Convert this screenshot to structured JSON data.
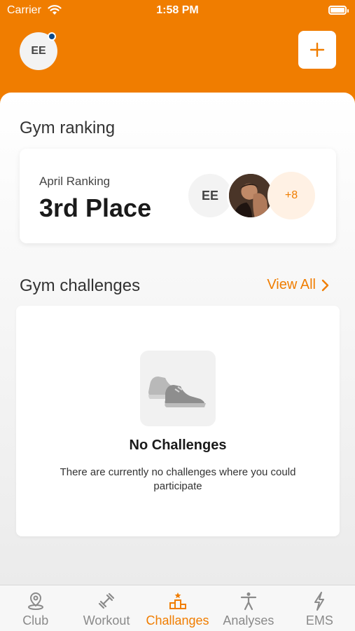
{
  "status": {
    "carrier": "Carrier",
    "time": "1:58 PM"
  },
  "header": {
    "avatar_initials": "EE",
    "add_label": "+"
  },
  "ranking": {
    "section_title": "Gym ranking",
    "month_label": "April Ranking",
    "place": "3rd Place",
    "avatar_initials": "EE",
    "more_count": "+8"
  },
  "challenges": {
    "section_title": "Gym challenges",
    "view_all": "View All",
    "empty_title": "No Challenges",
    "empty_desc": "There are currently no challenges where you could participate"
  },
  "tabs": [
    {
      "label": "Club",
      "icon": "location-pin-icon",
      "active": false
    },
    {
      "label": "Workout",
      "icon": "dumbbell-icon",
      "active": false
    },
    {
      "label": "Challanges",
      "icon": "podium-icon",
      "active": true
    },
    {
      "label": "Analyses",
      "icon": "person-icon",
      "active": false
    },
    {
      "label": "EMS",
      "icon": "lightning-icon",
      "active": false
    }
  ],
  "colors": {
    "accent": "#F07D00",
    "notification_dot": "#0c4a8a"
  }
}
